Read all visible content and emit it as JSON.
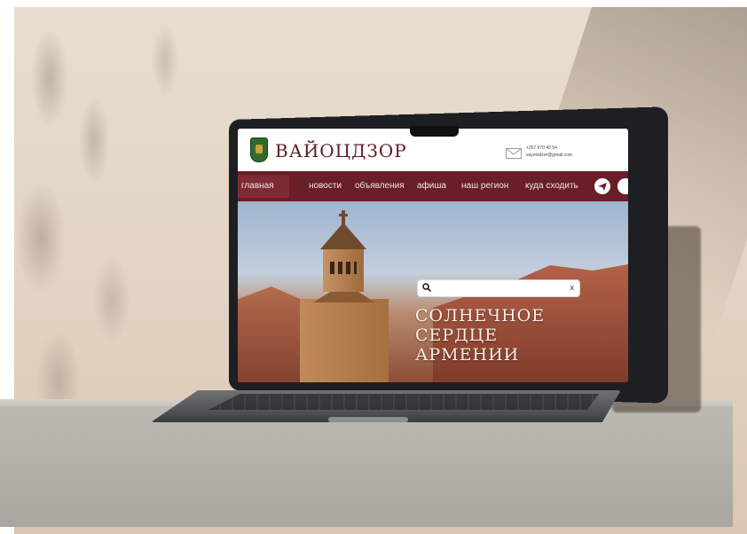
{
  "site": {
    "logo_text": "ВАЙОЦДЗОР",
    "contacts": {
      "phone": "+357 670 40 54",
      "email": "vayotsdzor@gmail.com"
    }
  },
  "nav": {
    "items": [
      {
        "label": "главная",
        "active": true
      },
      {
        "label": "новости",
        "active": false
      },
      {
        "label": "объявления",
        "active": false
      },
      {
        "label": "афиша",
        "active": false
      },
      {
        "label": "наш регион",
        "active": false
      },
      {
        "label": "куда сходить",
        "active": false
      }
    ],
    "icons": [
      "telegram-icon",
      "social-icon"
    ]
  },
  "hero": {
    "search": {
      "value": "",
      "clear_label": "x"
    },
    "slogan": [
      "СОЛНЕЧНОЕ",
      "СЕРДЦЕ",
      "АРМЕНИИ"
    ]
  },
  "colors": {
    "brand": "#6a1e27",
    "logo": "#5e1d23",
    "header_bg": "#ffffff"
  }
}
